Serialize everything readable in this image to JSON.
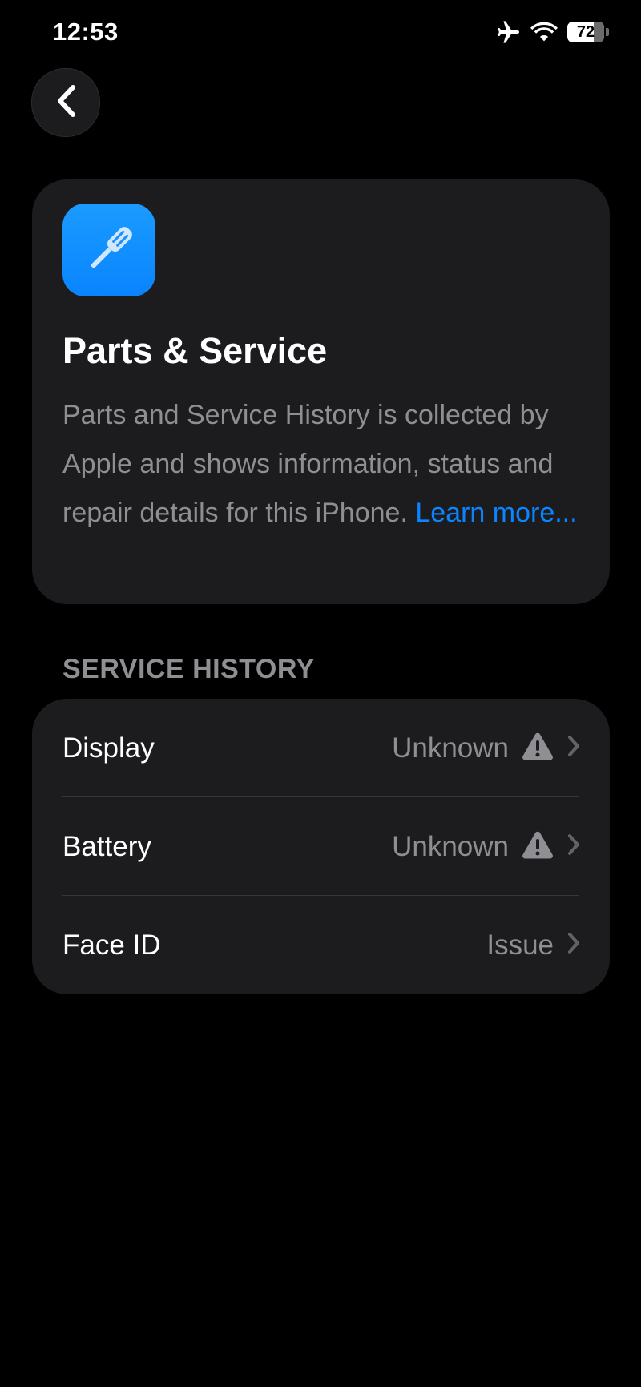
{
  "status_bar": {
    "time": "12:53",
    "battery": "72",
    "icons": [
      "airplane-icon",
      "wifi-icon",
      "battery-icon"
    ]
  },
  "nav": {
    "back_icon": "chevron-left-icon"
  },
  "header_card": {
    "icon": "screwdriver-icon",
    "icon_color": "#0a84ff",
    "title": "Parts & Service",
    "description": "Parts and Service History is collected by Apple and shows information, status and repair details for this iPhone.",
    "link_text": "Learn more..."
  },
  "service_history": {
    "section_title": "SERVICE HISTORY",
    "rows": [
      {
        "label": "Display",
        "value": "Unknown",
        "warning_icon": "warning-icon"
      },
      {
        "label": "Battery",
        "value": "Unknown",
        "warning_icon": "warning-icon"
      },
      {
        "label": "Face ID",
        "value": "Issue"
      }
    ]
  },
  "colors": {
    "background": "#000000",
    "card": "#1c1c1e",
    "secondary_text": "#8e8e93",
    "link": "#0a84ff"
  }
}
